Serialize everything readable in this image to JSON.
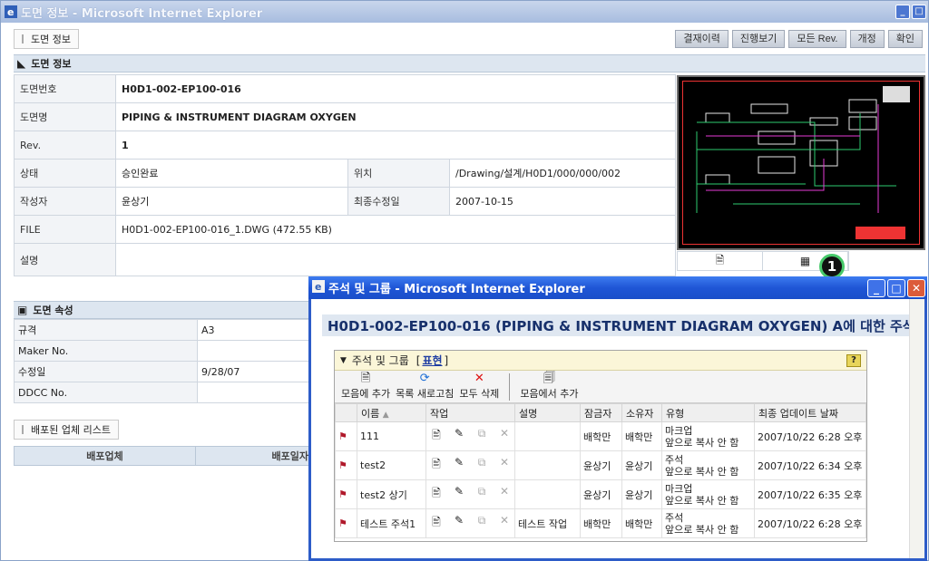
{
  "window": {
    "title": "도면 정보 - Microsoft Internet Explorer"
  },
  "tab": {
    "label": "도면 정보"
  },
  "toolbar": {
    "buttons": [
      "결재이력",
      "진행보기",
      "모든 Rev.",
      "개정",
      "확인"
    ]
  },
  "drawing_info": {
    "header": "도면 정보",
    "rows": [
      {
        "label": "도면번호",
        "value": "H0D1-002-EP100-016"
      },
      {
        "label": "도면명",
        "value": "PIPING & INSTRUMENT DIAGRAM OXYGEN"
      },
      {
        "label": "Rev.",
        "value": "1"
      },
      {
        "label": "상태",
        "value": "승인완료",
        "label2": "위치",
        "value2": "/Drawing/설계/H0D1/000/000/002"
      },
      {
        "label": "작성자",
        "value": "윤상기",
        "label2": "최종수정일",
        "value2": "2007-10-15"
      },
      {
        "label": "FILE",
        "value": "H0D1-002-EP100-016_1.DWG (472.55 KB)"
      },
      {
        "label": "설명",
        "value": ""
      }
    ]
  },
  "attributes": {
    "header": "도면 속성",
    "rows": [
      {
        "label": "규격",
        "value": "A3"
      },
      {
        "label": "Maker No.",
        "value": ""
      },
      {
        "label": "수정일",
        "value": "9/28/07"
      },
      {
        "label": "DDCC No.",
        "value": ""
      }
    ]
  },
  "distribution": {
    "tab": "배포된 업체 리스트",
    "columns": [
      "배포업체",
      "배포일자"
    ]
  },
  "badge": "1",
  "popup": {
    "title": "주석 및 그룹 - Microsoft Internet Explorer",
    "heading": "H0D1-002-EP100-016 (PIPING & INSTRUMENT DIAGRAM OXYGEN) A에 대한 주석",
    "panel_title": "주석 및 그룹",
    "panel_link": "표현",
    "tools": [
      "모음에 추가",
      "목록 새로고침",
      "모두 삭제",
      "모음에서 추가"
    ],
    "columns": [
      "이름",
      "작업",
      "설명",
      "잠금자",
      "소유자",
      "유형",
      "최종 업데이트 날짜"
    ],
    "rows": [
      {
        "name": "111",
        "desc": "",
        "locker": "배학만",
        "owner": "배학만",
        "type1": "마크업",
        "type2": "앞으로 복사 안 함",
        "date": "2007/10/22 6:28 오후"
      },
      {
        "name": "test2",
        "desc": "",
        "locker": "윤상기",
        "owner": "윤상기",
        "type1": "주석",
        "type2": "앞으로 복사 안 함",
        "date": "2007/10/22 6:34 오후"
      },
      {
        "name": "test2 상기",
        "desc": "",
        "locker": "윤상기",
        "owner": "윤상기",
        "type1": "마크업",
        "type2": "앞으로 복사 안 함",
        "date": "2007/10/22 6:35 오후"
      },
      {
        "name": "테스트 주석1",
        "desc": "테스트 작업",
        "locker": "배학만",
        "owner": "배학만",
        "type1": "주석",
        "type2": "앞으로 복사 안 함",
        "date": "2007/10/22 6:28 오후"
      }
    ]
  }
}
